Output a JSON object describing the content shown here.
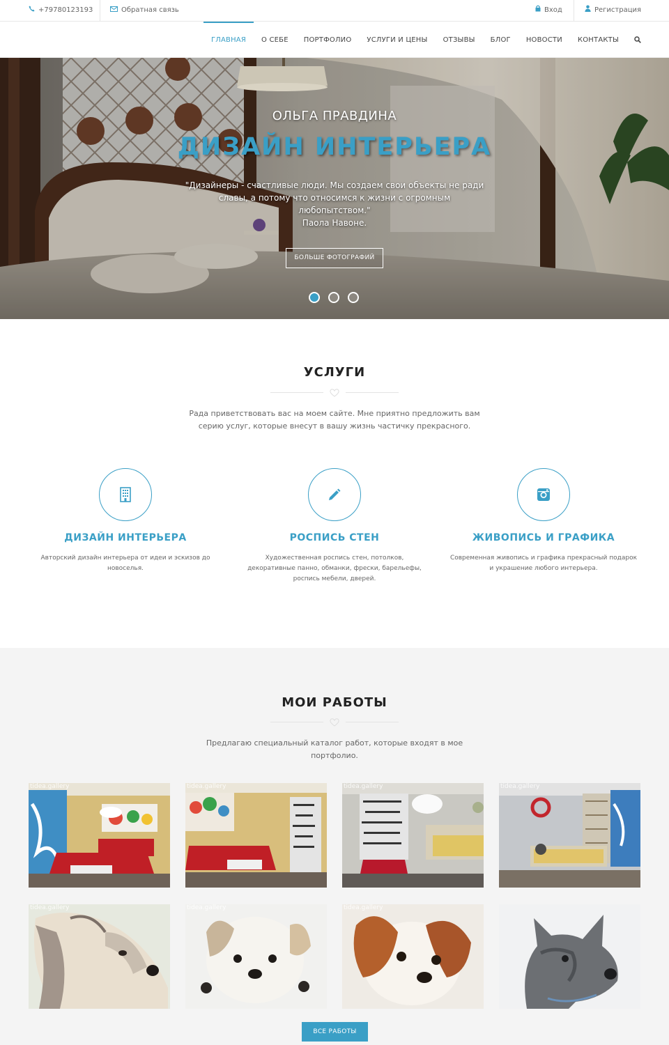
{
  "topbar": {
    "phone": "+79780123193",
    "feedback": "Обратная связь",
    "login": "Вход",
    "register": "Регистрация"
  },
  "nav": {
    "items": [
      "ГЛАВНАЯ",
      "О СЕБЕ",
      "ПОРТФОЛИО",
      "УСЛУГИ И ЦЕНЫ",
      "ОТЗЫВЫ",
      "БЛОГ",
      "НОВОСТИ",
      "КОНТАКТЫ"
    ],
    "active": "ГЛАВНАЯ"
  },
  "hero": {
    "subtitle": "ОЛЬГА ПРАВДИНА",
    "title": "ДИЗАЙН ИНТЕРЬЕРА",
    "quote_1": "\"Дизайнеры - счастливые люди. Мы создаем свои объекты не ради",
    "quote_2": "славы, а потому что относимся к жизни с огромным",
    "quote_3": "любопытством.\"",
    "quote_author": "Паола Навоне.",
    "button": "БОЛЬШЕ ФОТОГРАФИЙ",
    "slide_count": 3,
    "active_slide": 1
  },
  "services": {
    "title": "УСЛУГИ",
    "lead": "Рада приветствовать вас на моем сайте. Мне приятно предложить вам серию услуг, которые внесут в вашу жизнь частичку прекрасного.",
    "items": [
      {
        "icon": "building-icon",
        "title": "ДИЗАЙН ИНТЕРЬЕРА",
        "text": "Авторский дизайн интерьера от идеи и эскизов до новоселья."
      },
      {
        "icon": "pencil-icon",
        "title": "РОСПИСЬ СТЕН",
        "text": "Художественная роспись стен, потолков, декоративные панно, обманки, фрески, барельефы, роспись мебели, дверей."
      },
      {
        "icon": "instagram-icon",
        "title": "ЖИВОПИСЬ И ГРАФИКА",
        "text": "Современная живопись и графика прекрасный подарок и украшение любого интерьера."
      }
    ]
  },
  "works": {
    "title": "МОИ РАБОТЫ",
    "lead": "Предлагаю специальный каталог работ, которые входят в мое портфолио.",
    "watermark": "tidea.gallery",
    "button": "ВСЕ РАБОТЫ"
  },
  "colors": {
    "accent": "#3a9fc6",
    "works_bg": "#f4f4f4"
  }
}
